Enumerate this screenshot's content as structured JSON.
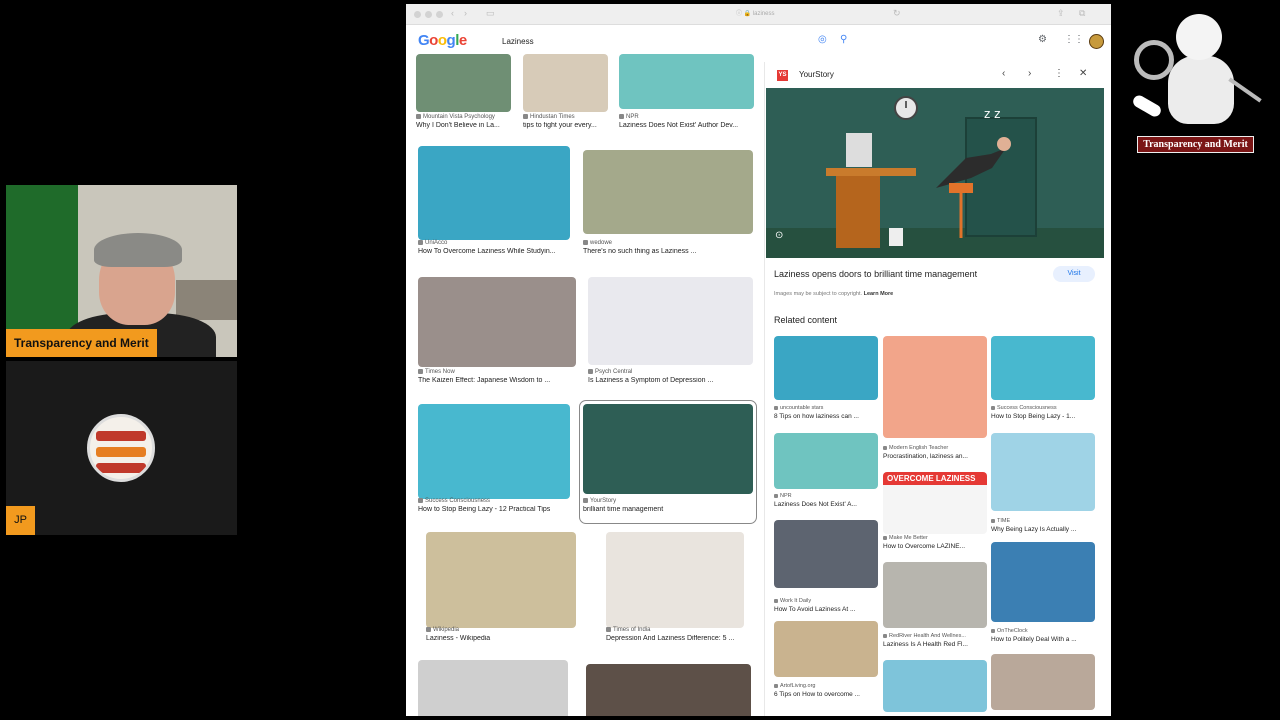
{
  "participant": {
    "name_label": "Transparency and Merit",
    "initials": "JP"
  },
  "corner_logo": {
    "label": "Transparency and Merit"
  },
  "browser": {
    "address": "ⓘ 🔒 laziness"
  },
  "search": {
    "logo_letters": [
      "G",
      "o",
      "o",
      "g",
      "l",
      "e"
    ],
    "query": "Laziness"
  },
  "results": [
    {
      "source": "Mountain Vista Psychology",
      "title": "Why I Don't Believe in La...",
      "color": "#6f8f74"
    },
    {
      "source": "Hindustan Times",
      "title": "tips to fight your every...",
      "color": "#d7cbb8"
    },
    {
      "source": "NPR",
      "title": "Laziness Does Not Exist' Author Dev...",
      "color": "#6fc4c0"
    },
    {
      "source": "UniAcco",
      "title": "How To Overcome Laziness While Studyin...",
      "color": "#3aa6c4"
    },
    {
      "source": "wedowe",
      "title": "There's no such thing as Laziness ...",
      "color": "#a4a98b"
    },
    {
      "source": "Times Now",
      "title": "The Kaizen Effect: Japanese Wisdom to ...",
      "color": "#9a8f8b"
    },
    {
      "source": "Psych Central",
      "title": "Is Laziness a Symptom of Depression ...",
      "color": "#e9e9ee"
    },
    {
      "source": "Success Consciousness",
      "title": "How to Stop Being Lazy - 12 Practical Tips",
      "color": "#48b8cf"
    },
    {
      "source": "YourStory",
      "title": "brilliant time management",
      "color": "#2e5e55"
    },
    {
      "source": "Wikipedia",
      "title": "Laziness - Wikipedia",
      "color": "#cdbf9c"
    },
    {
      "source": "Times of India",
      "title": "Depression And Laziness Difference: 5 ...",
      "color": "#e9e4de"
    },
    {
      "source": "",
      "title": "",
      "color": "#cfcfcf"
    },
    {
      "source": "",
      "title": "",
      "color": "#5d5048"
    }
  ],
  "panel": {
    "source_name": "YourStory",
    "source_badge": "YS",
    "prev_icon": "‹",
    "next_icon": "›",
    "more_icon": "⋮",
    "close_icon": "✕",
    "title": "Laziness opens doors to brilliant time management",
    "visit_label": "Visit",
    "copyright_text": "Images may be subject to copyright.",
    "learn_more": "Learn More",
    "related_heading": "Related content",
    "related": [
      {
        "source": "uncountable stars",
        "title": "8 Tips on how laziness can ...",
        "color": "#3aa6c4"
      },
      {
        "source": "Modern English Teacher",
        "title": "Procrastination, laziness an...",
        "color": "#f2a58a"
      },
      {
        "source": "Success Consciousness",
        "title": "How to Stop Being Lazy - 1...",
        "color": "#48b8cf"
      },
      {
        "source": "NPR",
        "title": "Laziness Does Not Exist' A...",
        "color": "#6fc4c0"
      },
      {
        "source": "Make Me Better",
        "title": "How to Overcome LAZINE...",
        "color": "#e53935",
        "banner": "OVERCOME LAZINESS"
      },
      {
        "source": "TIME",
        "title": "Why Being Lazy Is Actually ...",
        "color": "#9fd3e6"
      },
      {
        "source": "Work It Daily",
        "title": "How To Avoid Laziness At ...",
        "color": "#5d6470"
      },
      {
        "source": "RedRiver Health And Wellnes...",
        "title": "Laziness Is A Health Red Fl...",
        "color": "#b7b5ae"
      },
      {
        "source": "OnTheClock",
        "title": "How to Politely Deal With a ...",
        "color": "#3b7fb3"
      },
      {
        "source": "ArtofLiving.org",
        "title": "6 Tips on How to overcome ...",
        "color": "#c9b38f"
      },
      {
        "source": "",
        "title": "",
        "color": "#7ec4da"
      },
      {
        "source": "",
        "title": "",
        "color": "#b9a89a"
      }
    ]
  }
}
